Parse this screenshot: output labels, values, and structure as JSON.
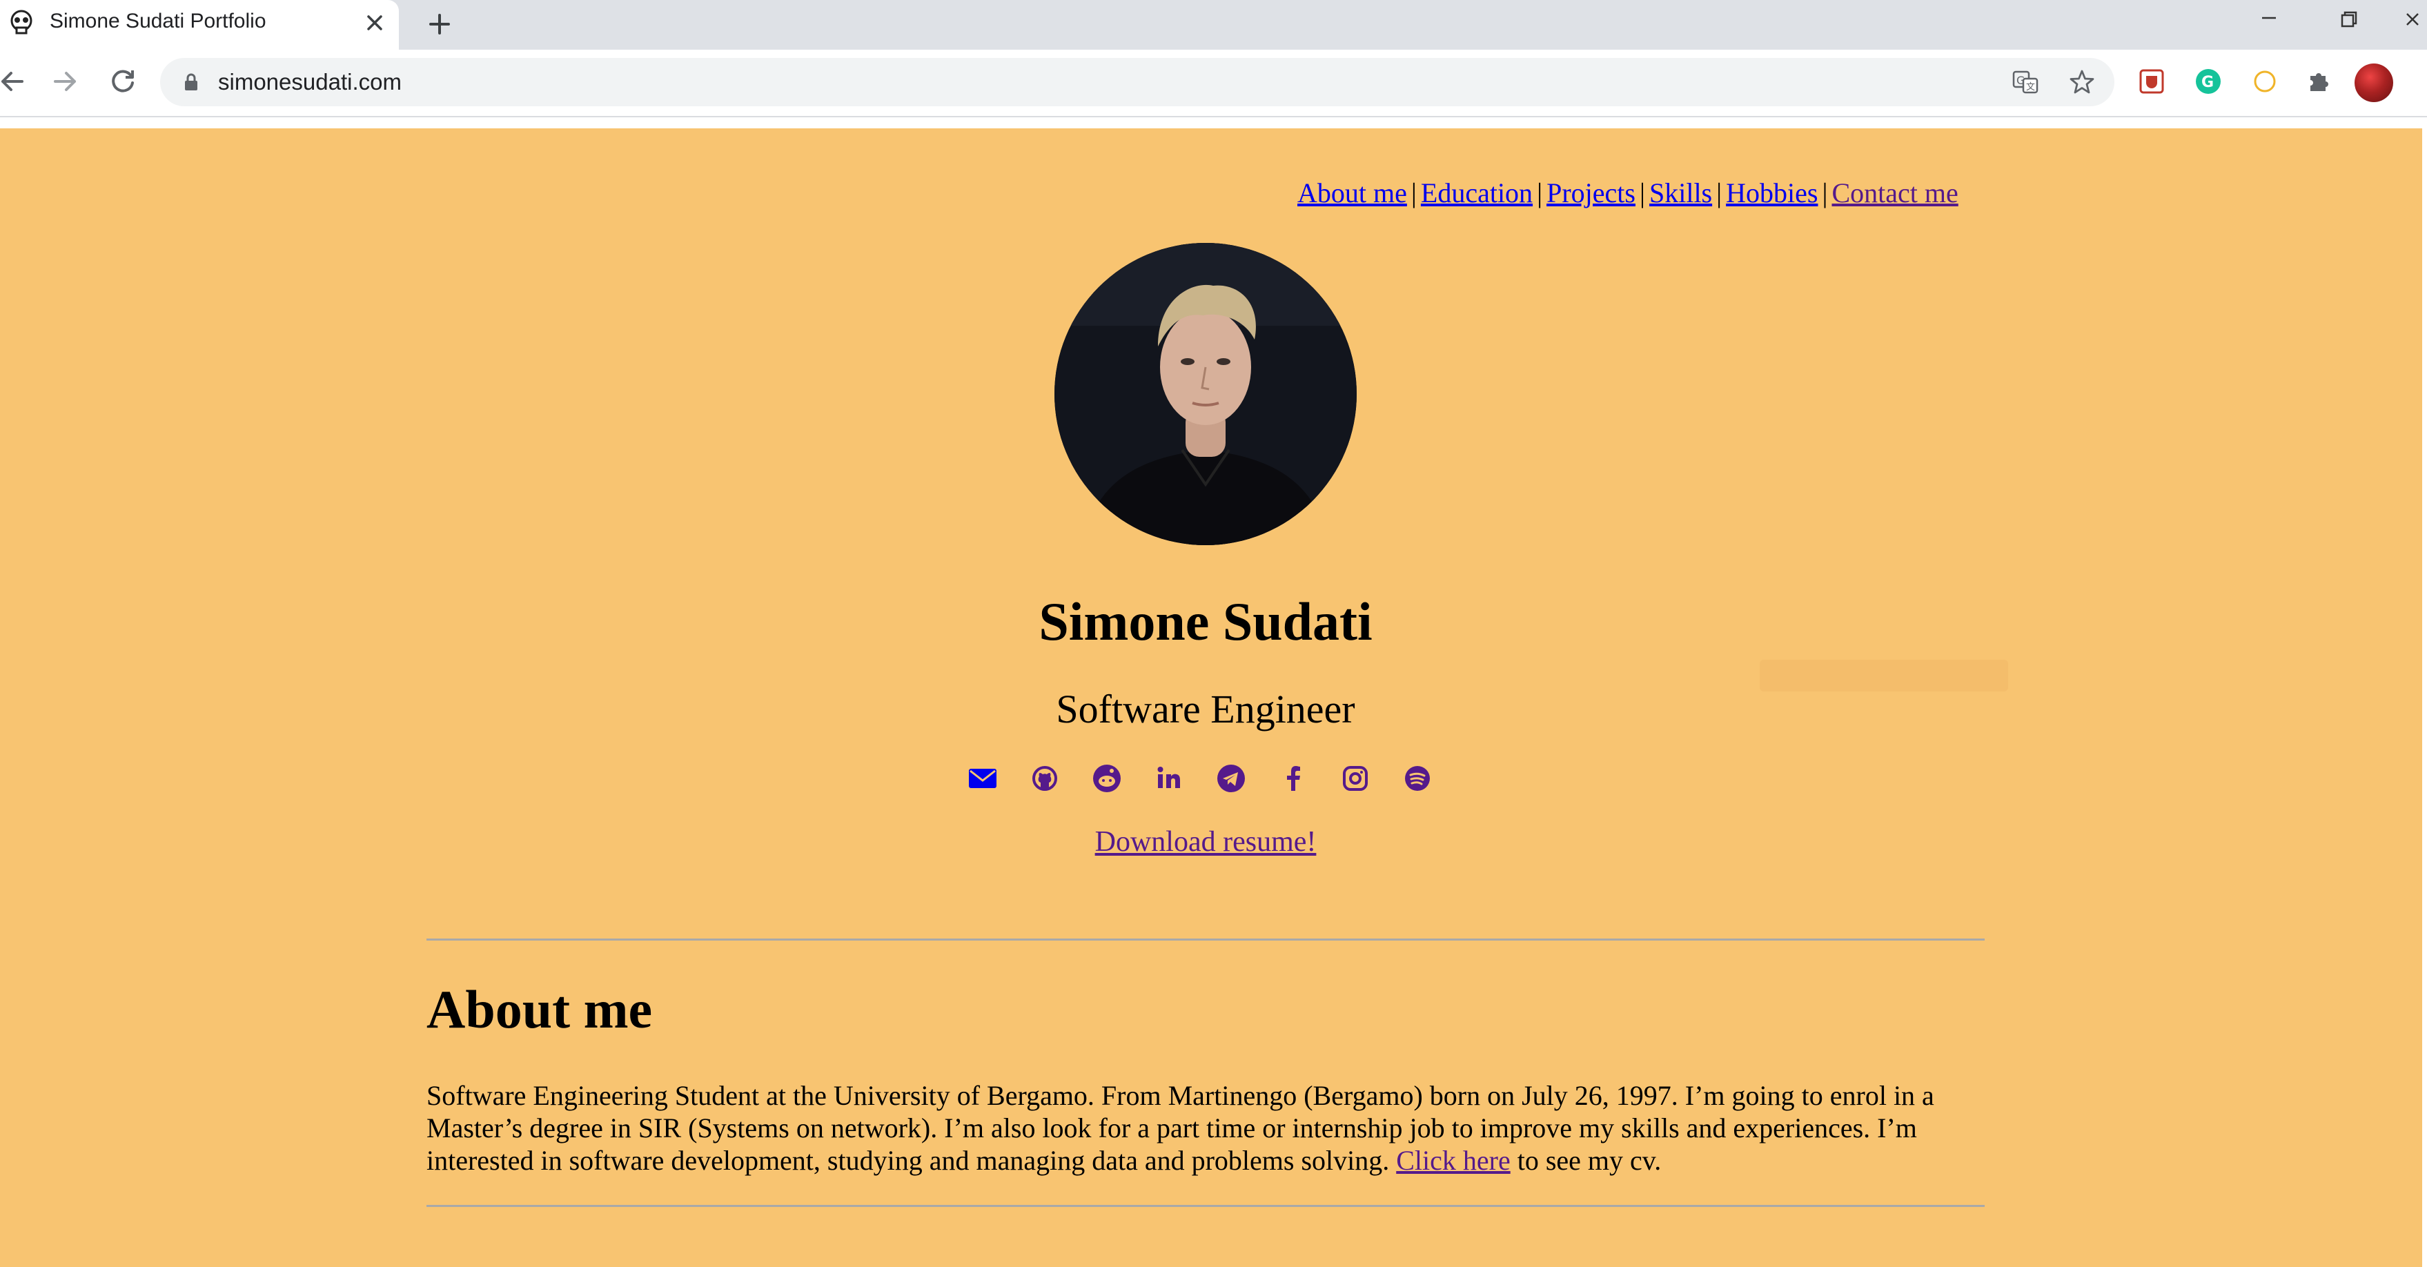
{
  "browser": {
    "tab_title": "Simone Sudati Portfolio",
    "url": "simonesudati.com",
    "icons": {
      "favicon": "skull-icon",
      "close": "close-icon",
      "new_tab": "plus-icon",
      "back": "back-arrow-icon",
      "forward": "forward-arrow-icon",
      "reload": "reload-icon",
      "lock": "lock-icon",
      "translate": "translate-icon",
      "bookmark": "star-icon",
      "extensions": [
        "shield-extension-icon",
        "grammarly-icon",
        "compass-extension-icon",
        "puzzle-icon"
      ],
      "profile": "avatar",
      "window": [
        "minimize-icon",
        "restore-icon",
        "close-window-icon"
      ]
    }
  },
  "page": {
    "background": "#f8c471",
    "nav": [
      "About me",
      "Education",
      "Projects",
      "Skills",
      "Hobbies",
      "Contact me"
    ],
    "nav_separator": "|",
    "name": "Simone Sudati",
    "role": "Software Engineer",
    "social_icons": [
      "email-icon",
      "github-icon",
      "reddit-icon",
      "linkedin-icon",
      "telegram-icon",
      "facebook-icon",
      "instagram-icon",
      "spotify-icon"
    ],
    "resume_link": "Download resume!",
    "about": {
      "title": "About me",
      "text": "Software Engineering Student at the University of Bergamo. From Martinengo (Bergamo) born on July 26, 1997. I’m going to enrol in a Master’s degree in SIR (Systems on network). I’m also look for a part time or internship job to improve my skills and experiences. I’m interested in software development, studying and managing data and problems solving.",
      "link": "Click here",
      "suffix": "to see my cv."
    }
  }
}
